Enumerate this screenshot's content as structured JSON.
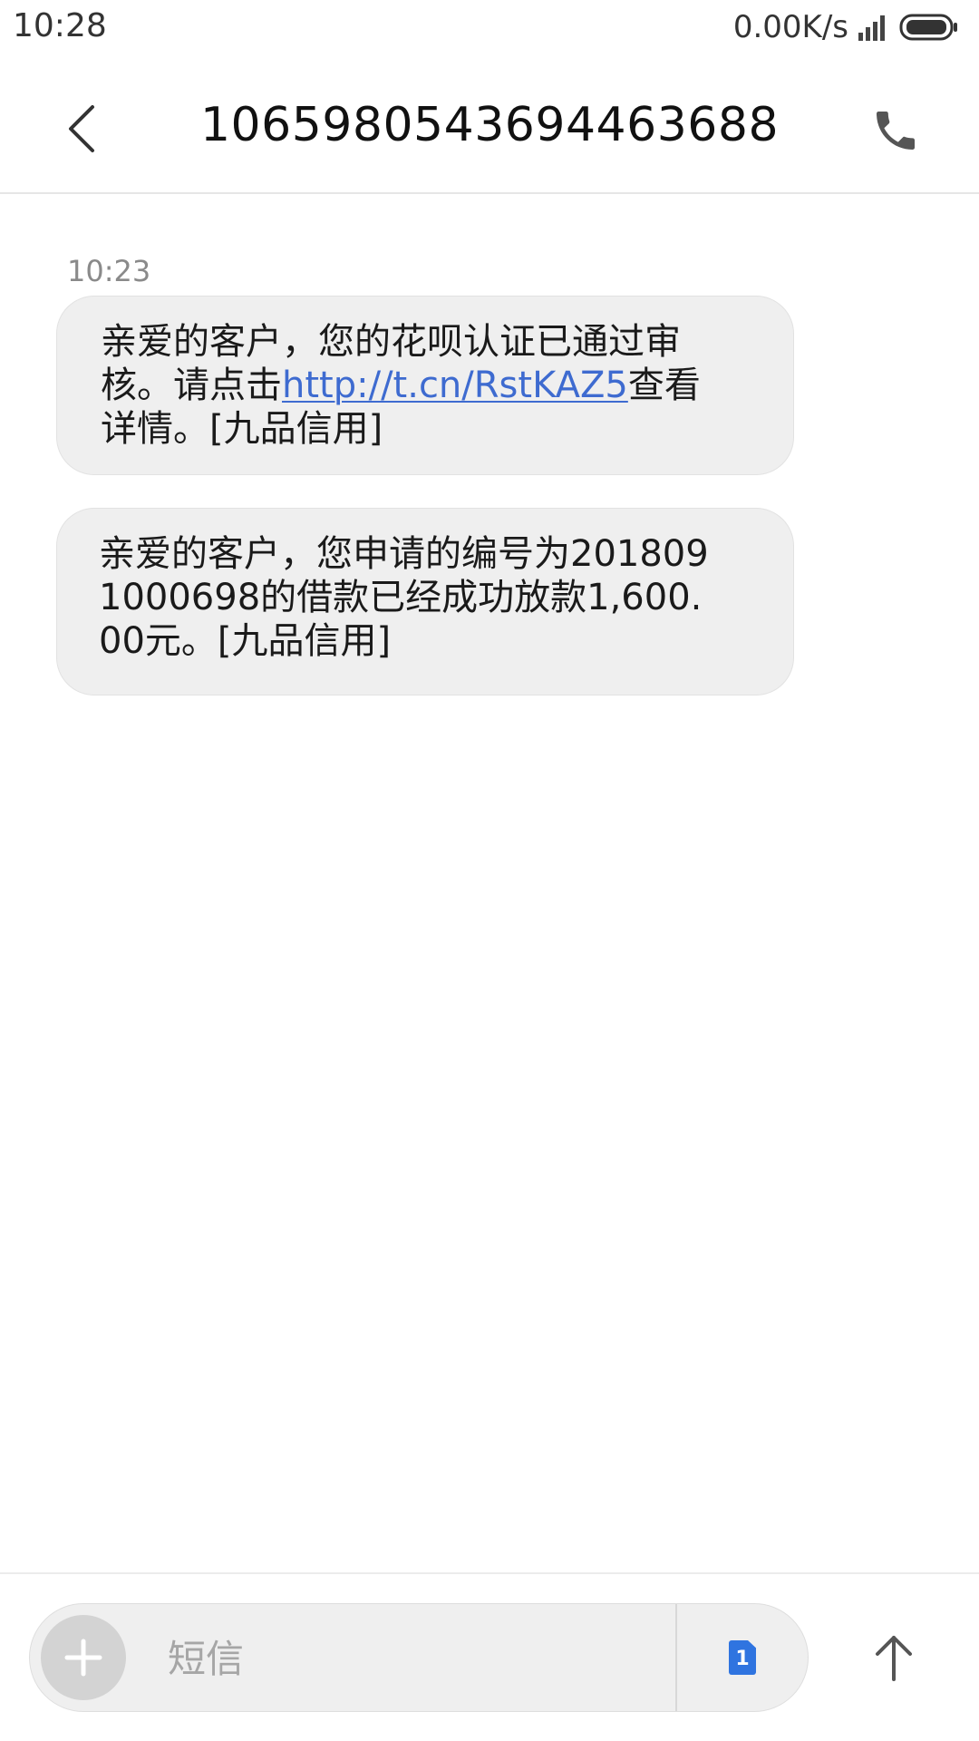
{
  "status_bar": {
    "time": "10:28",
    "network_speed": "0.00K/s",
    "signal_icon": "signal-icon",
    "battery_icon": "battery-icon"
  },
  "header": {
    "back_icon": "chevron-left-icon",
    "title": "1065980543694463688",
    "call_icon": "phone-icon"
  },
  "conversation": {
    "timestamp": "10:23",
    "messages": [
      {
        "before_link": "亲爱的客户，您的花呗认证已通过审核。请点击",
        "link": "http://t.cn/RstKAZ5",
        "after_link": "查看详情。[九品信用]"
      },
      {
        "text": "亲爱的客户，您申请的编号为2018091000698的借款已经成功放款1,600.00元。[九品信用]"
      }
    ]
  },
  "compose": {
    "add_icon": "plus-icon",
    "placeholder": "短信",
    "value": "",
    "sim_label": "1",
    "sim_icon": "sim-card-icon",
    "send_icon": "arrow-up-icon"
  },
  "colors": {
    "bubble_bg": "#efefef",
    "link": "#3e6bd0",
    "sim_badge": "#2f74e0",
    "secondary_text": "#8a8a8a"
  }
}
